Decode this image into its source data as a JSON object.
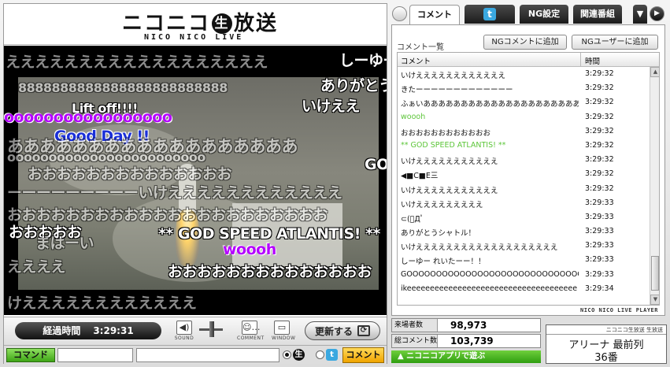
{
  "logo": {
    "main_left": "ニコニコ",
    "main_mark": "生",
    "main_right": "放送",
    "sub": "NICO NICO LIVE"
  },
  "overlay_comments": [
    "ええええええええええええええええええ",
    "しーゆー",
    "8888888888888888888888888",
    "ありがとう",
    "Lift off!!!!",
    "いけええ",
    "ooooooooooooooooo",
    "Good Day !!",
    "ああああああああああああああああああ",
    "oooooooooooooooooooooooo",
    "GO",
    "おおおおおおおおおおおおおお",
    "ーーーーーーーーーいけええええええええええええ",
    "おおおおおおおおおおおおおおおおおおおおおお",
    "おおおおお",
    "まはーい",
    "** GOD SPEED ATLANTIS! **",
    "woooh",
    "おおおおおおおおおおおおおお",
    "ええええ",
    "けええええええええええええ"
  ],
  "controls": {
    "elapsed_label": "経過時間",
    "elapsed_value": "3:29:31",
    "sound_label": "SOUND",
    "comment_label": "COMMENT",
    "window_label": "WINDOW",
    "refresh_label": "更新する"
  },
  "command": {
    "command_button": "コマンド",
    "command_value": "",
    "comment_value": "",
    "nama_mark": "生",
    "twitter_mark": "t",
    "comment_button": "コメント"
  },
  "tabs": [
    {
      "label": "コメント"
    },
    {
      "label": "t"
    },
    {
      "label": "NG設定"
    },
    {
      "label": "関連番組"
    }
  ],
  "comment_panel": {
    "title": "コメント一覧",
    "ng_comment_button": "NGコメントに追加",
    "ng_user_button": "NGユーザーに追加",
    "col_comment": "コメント",
    "col_time": "時間",
    "footer": "NICO NICO LIVE PLAYER",
    "rows": [
      {
        "comment": "いけええええええええええええ",
        "time": "3:29:32",
        "color": "#111111"
      },
      {
        "comment": "きたーーーーーーーーーーーーー",
        "time": "3:29:32",
        "color": "#111111"
      },
      {
        "comment": "ふぁいあああああああああああああああああああああ",
        "time": "3:29:32",
        "color": "#111111"
      },
      {
        "comment": "woooh",
        "time": "3:29:32",
        "color": "#5dc63a"
      },
      {
        "comment": "おおおおおおおおおおおお",
        "time": "3:29:32",
        "color": "#111111"
      },
      {
        "comment": "** GOD SPEED ATLANTIS! **",
        "time": "3:29:32",
        "color": "#5dc63a"
      },
      {
        "comment": "いけえええええええええええ",
        "time": "3:29:32",
        "color": "#111111"
      },
      {
        "comment": "◀■C■E三",
        "time": "3:29:32",
        "color": "#111111"
      },
      {
        "comment": "いけえええええええええええ",
        "time": "3:29:32",
        "color": "#111111"
      },
      {
        "comment": "いけえええええええええ",
        "time": "3:29:33",
        "color": "#111111"
      },
      {
        "comment": "⊂(ﾟДﾟ",
        "time": "3:29:33",
        "color": "#111111"
      },
      {
        "comment": "ありがとうシャトル！",
        "time": "3:29:33",
        "color": "#111111"
      },
      {
        "comment": "いけえええええええええええええええええええ",
        "time": "3:29:33",
        "color": "#111111"
      },
      {
        "comment": "しーゆー れいたーー！！",
        "time": "3:29:33",
        "color": "#111111"
      },
      {
        "comment": "GOOOOOOOOOOOOOOOOOOOOOOOOOOOOOOOOO",
        "time": "3:29:33",
        "color": "#111111"
      },
      {
        "comment": "ikeeeeeeeeeeeeeeeeeeeeeeeeeeeeeeeeeeeee",
        "time": "3:29:34",
        "color": "#111111"
      }
    ]
  },
  "stats": {
    "visitors_label": "来場者数",
    "visitors_value": "98,973",
    "comments_label": "総コメント数",
    "comments_value": "103,739",
    "app_button": "▲ ニコニコアプリで遊ぶ"
  },
  "seat": {
    "header": "ニコニコ生放送 生放送",
    "area": "アリーナ 最前列",
    "number": "36番"
  }
}
